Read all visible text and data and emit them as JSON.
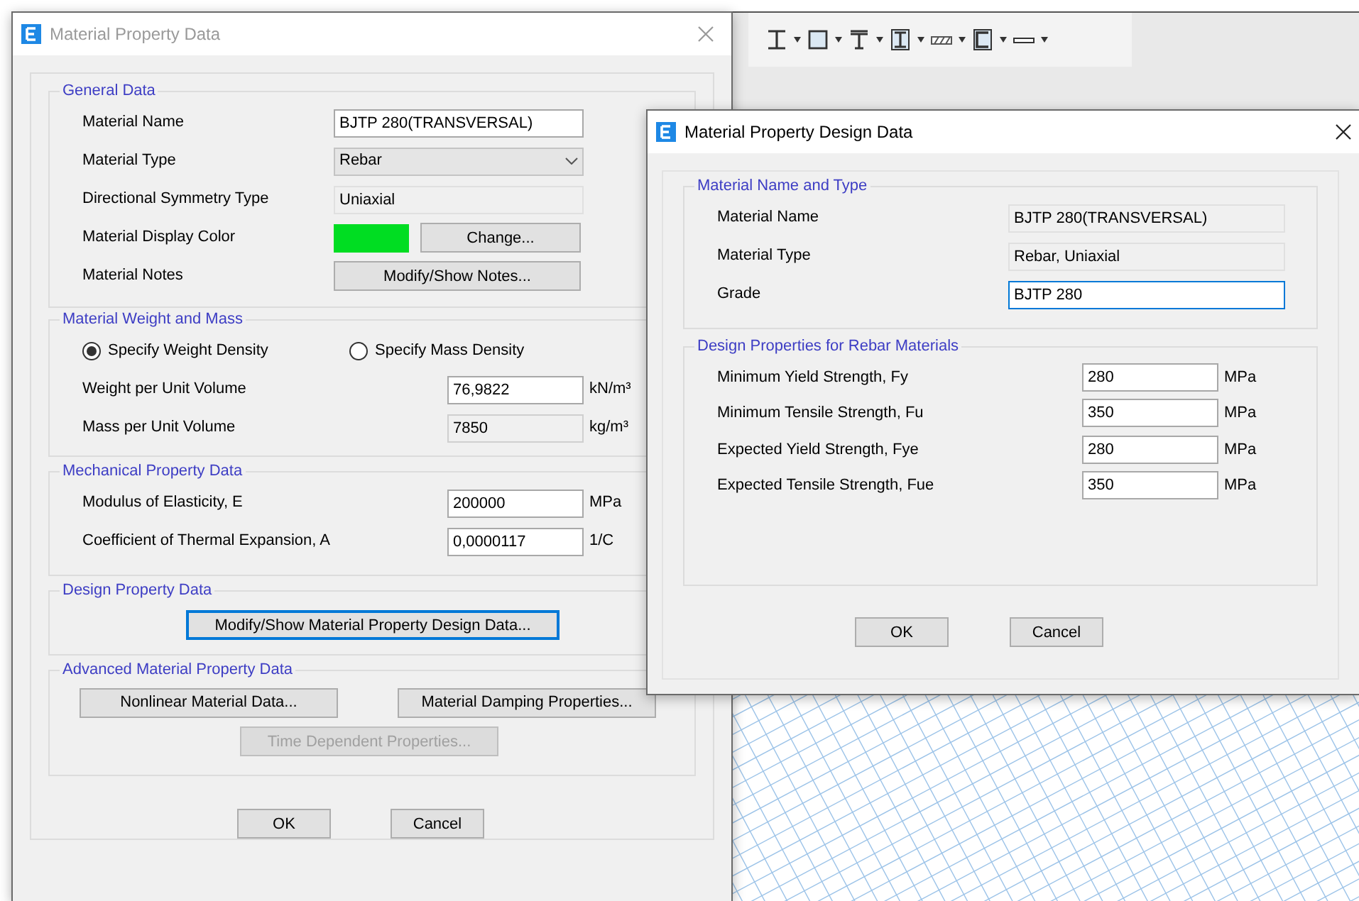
{
  "main_dialog": {
    "title": "Material Property Data",
    "active": false,
    "general": {
      "title": "General Data",
      "fields": [
        {
          "kind": "text",
          "label": "Material Name",
          "value": "BJTP 280(TRANSVERSAL)"
        },
        {
          "kind": "select",
          "label": "Material Type",
          "value": "Rebar"
        },
        {
          "kind": "readonly",
          "label": "Directional Symmetry Type",
          "value": "Uniaxial"
        },
        {
          "kind": "color",
          "label": "Material Display Color",
          "color": "#00dd22",
          "button": "Change..."
        },
        {
          "kind": "button",
          "label": "Material Notes",
          "button": "Modify/Show Notes..."
        }
      ]
    },
    "weight": {
      "title": "Material Weight and Mass",
      "options": [
        {
          "label": "Specify Weight Density",
          "selected": true
        },
        {
          "label": "Specify Mass Density",
          "selected": false
        }
      ],
      "fields": [
        {
          "label": "Weight per Unit Volume",
          "value": "76,9822",
          "unit": "kN/m³",
          "disabled": false
        },
        {
          "label": "Mass per Unit Volume",
          "value": "7850",
          "unit": "kg/m³",
          "disabled": true
        }
      ]
    },
    "mechanical": {
      "title": "Mechanical Property Data",
      "fields": [
        {
          "label": "Modulus of Elasticity,  E",
          "value": "200000",
          "unit": "MPa",
          "disabled": false
        },
        {
          "label": "Coefficient of Thermal Expansion,  A",
          "value": "0,0000117",
          "unit": "1/C",
          "disabled": false
        }
      ]
    },
    "design": {
      "title": "Design Property Data",
      "button": "Modify/Show Material Property Design Data...",
      "focused": true
    },
    "advanced": {
      "title": "Advanced Material Property Data",
      "buttons": [
        {
          "label": "Nonlinear Material Data...",
          "disabled": false
        },
        {
          "label": "Material Damping Properties...",
          "disabled": false
        },
        {
          "label": "Time Dependent Properties...",
          "disabled": true
        }
      ]
    },
    "buttons": [
      "OK",
      "Cancel"
    ]
  },
  "design_dialog": {
    "title": "Material Property Design Data",
    "active": true,
    "name_type": {
      "title": "Material Name and Type",
      "fields": [
        {
          "label": "Material Name",
          "value": "BJTP 280(TRANSVERSAL)",
          "readonly": true,
          "focused": false
        },
        {
          "label": "Material Type",
          "value": "Rebar, Uniaxial",
          "readonly": true,
          "focused": false
        },
        {
          "label": "Grade",
          "value": "BJTP 280",
          "readonly": false,
          "focused": true
        }
      ]
    },
    "rebar": {
      "title": "Design Properties for Rebar Materials",
      "fields": [
        {
          "label": "Minimum Yield Strength, Fy",
          "value": "280",
          "unit": "MPa"
        },
        {
          "label": "Minimum Tensile Strength, Fu",
          "value": "350",
          "unit": "MPa"
        },
        {
          "label": "Expected Yield Strength, Fye",
          "value": "280",
          "unit": "MPa"
        },
        {
          "label": "Expected Tensile Strength, Fue",
          "value": "350",
          "unit": "MPa"
        }
      ]
    },
    "buttons": [
      "OK",
      "Cancel"
    ]
  }
}
